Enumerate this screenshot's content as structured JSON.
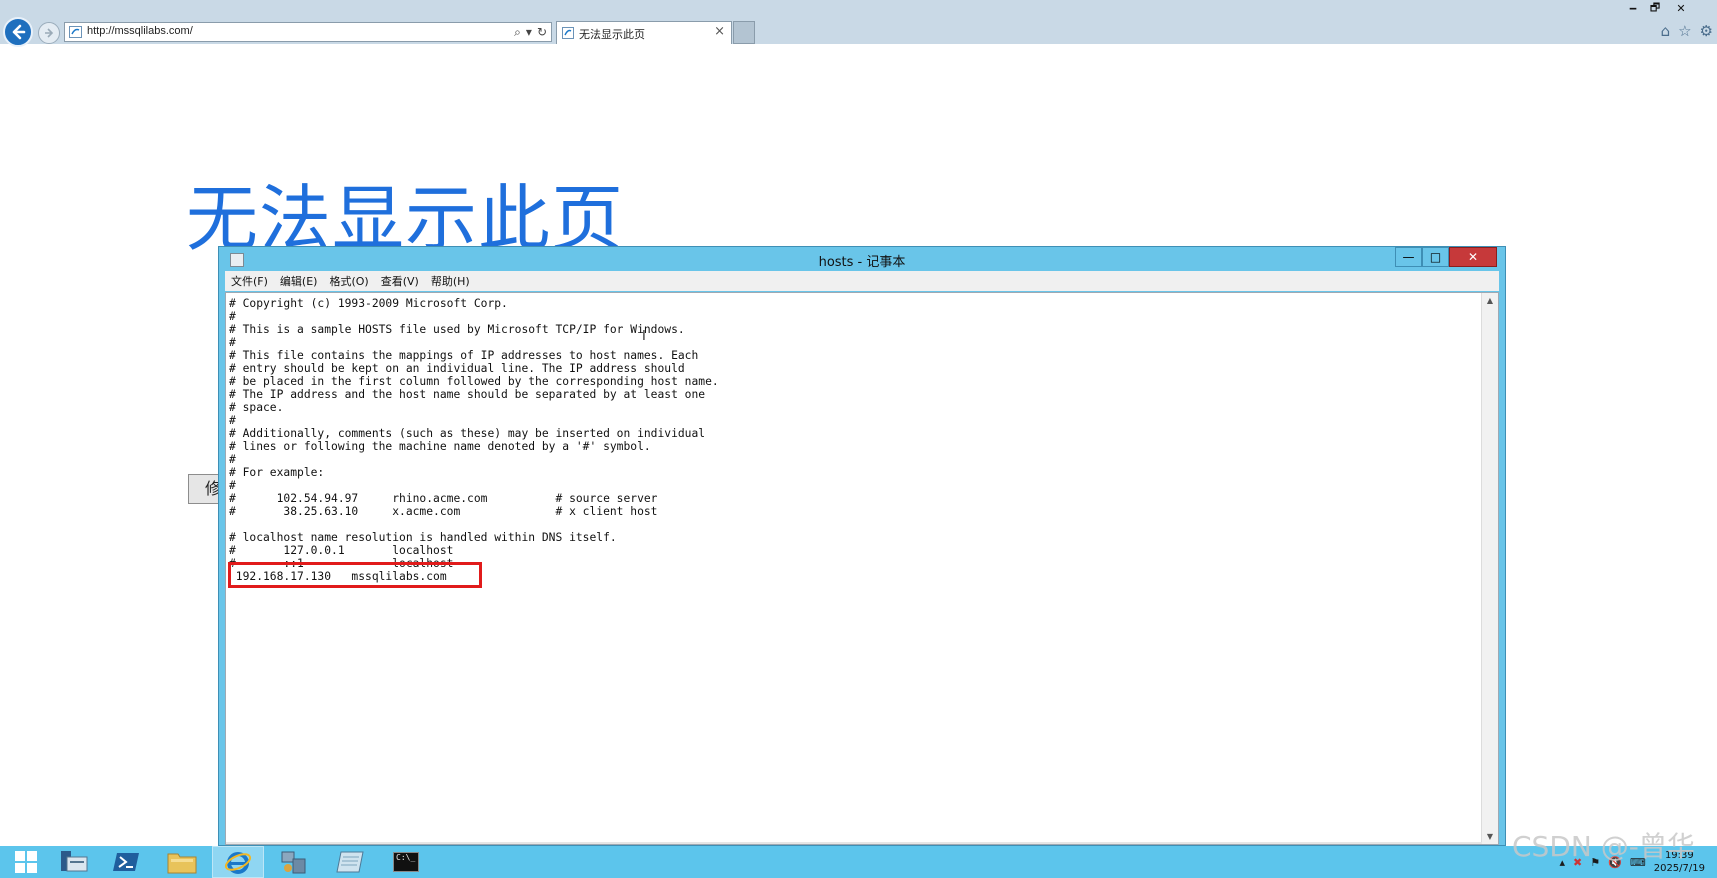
{
  "browser": {
    "address_url": "http://mssqlilabs.com/",
    "tab_title": "无法显示此页",
    "tab_close": "×",
    "address_tools": [
      "⌕",
      "▾",
      "↻"
    ],
    "window_controls": [
      "🗕",
      "🗗",
      "✕"
    ],
    "toolbar_icons": [
      "⌂",
      "☆",
      "⚙"
    ]
  },
  "page": {
    "title": "无法显示此页",
    "fix_button_label": "修"
  },
  "notepad": {
    "title": "hosts - 记事本",
    "controls": {
      "minimize": "—",
      "maximize": "□",
      "close": "✕"
    },
    "menu": [
      "文件(F)",
      "编辑(E)",
      "格式(O)",
      "查看(V)",
      "帮助(H)"
    ],
    "content": "# Copyright (c) 1993-2009 Microsoft Corp.\n#\n# This is a sample HOSTS file used by Microsoft TCP/IP for Windows.\n#\n# This file contains the mappings of IP addresses to host names. Each\n# entry should be kept on an individual line. The IP address should\n# be placed in the first column followed by the corresponding host name.\n# The IP address and the host name should be separated by at least one\n# space.\n#\n# Additionally, comments (such as these) may be inserted on individual\n# lines or following the machine name denoted by a '#' symbol.\n#\n# For example:\n#\n#      102.54.94.97     rhino.acme.com          # source server\n#       38.25.63.10     x.acme.com              # x client host\n\n# localhost name resolution is handled within DNS itself.\n#       127.0.0.1       localhost\n#       ::1             localhost\n 192.168.17.130   mssqlilabs.com",
    "scroll_up": "▲",
    "scroll_down": "▼"
  },
  "taskbar": {
    "items": [
      "start",
      "server-manager",
      "powershell",
      "file-explorer",
      "internet-explorer",
      "network-tool",
      "notepad",
      "cmd"
    ],
    "cmd_label": "C:\\_",
    "clock_time": "19:39",
    "clock_date": "2025/7/19"
  },
  "watermark": "CSDN @-曾华"
}
